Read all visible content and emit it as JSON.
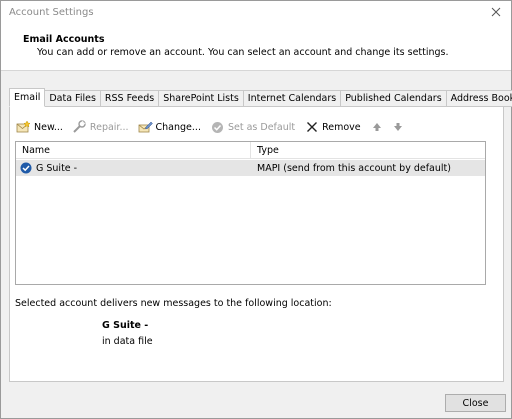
{
  "window": {
    "title": "Account Settings"
  },
  "header": {
    "title": "Email Accounts",
    "subtitle": "You can add or remove an account. You can select an account and change its settings."
  },
  "tabs": [
    {
      "label": "Email",
      "active": true
    },
    {
      "label": "Data Files"
    },
    {
      "label": "RSS Feeds"
    },
    {
      "label": "SharePoint Lists"
    },
    {
      "label": "Internet Calendars"
    },
    {
      "label": "Published Calendars"
    },
    {
      "label": "Address Books"
    }
  ],
  "toolbar": {
    "new_label": "New...",
    "repair_label": "Repair...",
    "change_label": "Change...",
    "set_default_label": "Set as Default",
    "remove_label": "Remove"
  },
  "list": {
    "columns": {
      "name": "Name",
      "type": "Type"
    },
    "rows": [
      {
        "name": "G Suite -",
        "type": "MAPI (send from this account by default)"
      }
    ]
  },
  "details": {
    "info": "Selected account delivers new messages to the following location:",
    "account": "G Suite -",
    "data_file": "in data file"
  },
  "footer": {
    "close_label": "Close"
  },
  "colors": {
    "check": "#1f5aa8",
    "selected_row": "#e5e5e5",
    "disabled_text": "#9a9a9a"
  }
}
